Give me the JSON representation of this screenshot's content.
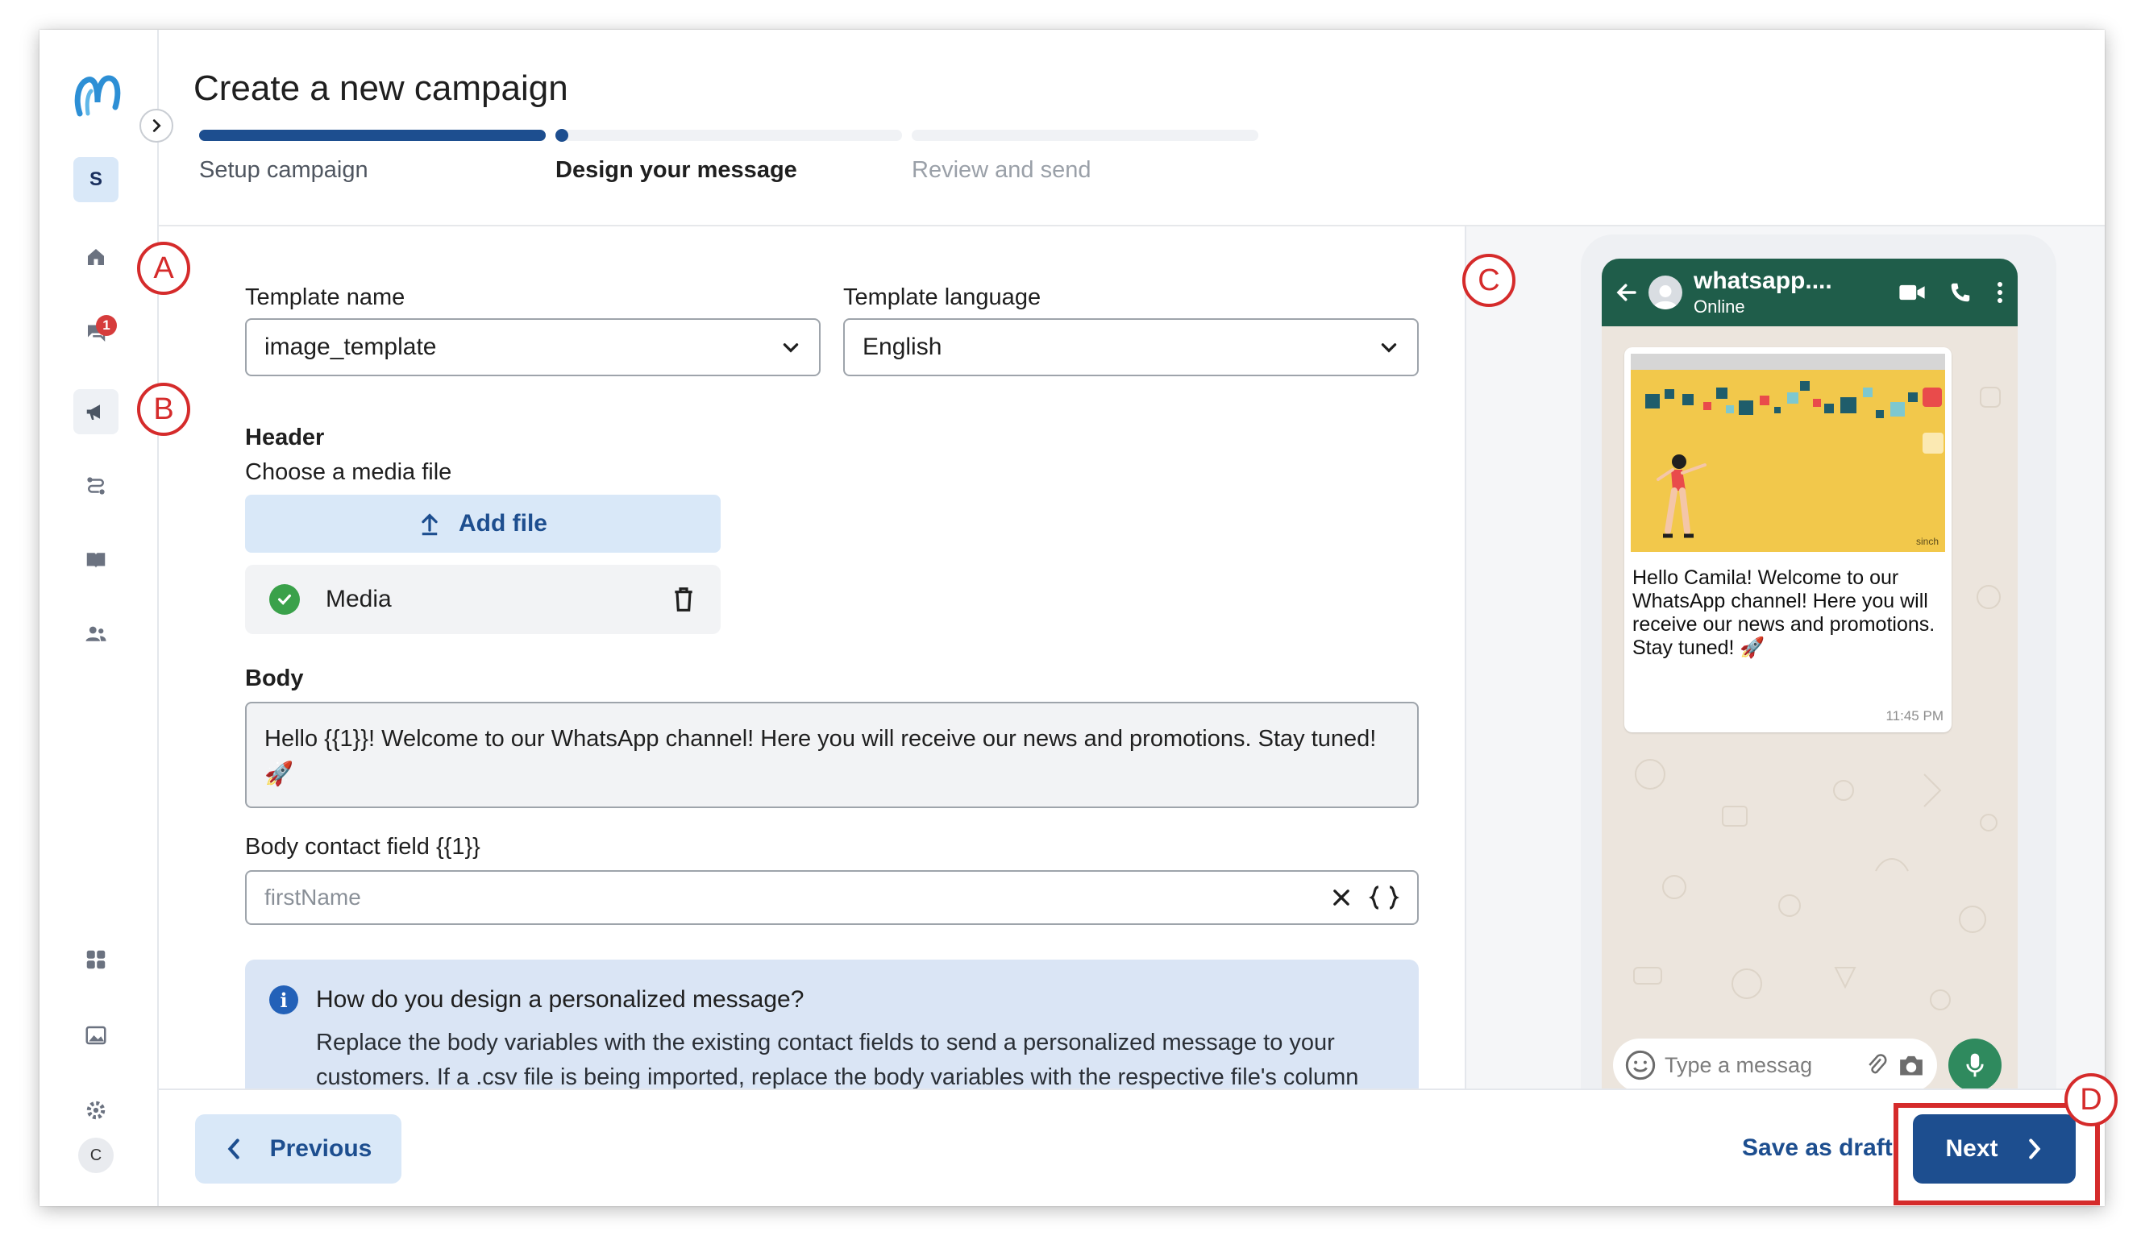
{
  "page": {
    "title": "Create a new campaign"
  },
  "sidebar": {
    "workspace_initial": "S",
    "notification_count": "1",
    "user_initial": "C"
  },
  "steps": [
    {
      "label": "Setup campaign",
      "state": "done"
    },
    {
      "label": "Design your message",
      "state": "active"
    },
    {
      "label": "Review and send",
      "state": "future"
    }
  ],
  "form": {
    "template_name_label": "Template name",
    "template_name_value": "image_template",
    "template_language_label": "Template language",
    "template_language_value": "English",
    "header_label": "Header",
    "choose_media_label": "Choose a media file",
    "add_file_label": "Add file",
    "media_file_name": "Media",
    "body_label": "Body",
    "body_text": "Hello {{1}}! Welcome to our WhatsApp channel! Here you will receive our news and promotions. Stay tuned! 🚀",
    "body_contact_field_label": "Body contact field {{1}}",
    "body_contact_field_placeholder": "firstName",
    "info_title": "How do you design a personalized message?",
    "info_text": "Replace the body variables with the existing contact fields to send a personalized message to your customers. If a .csv file is being imported, replace the body variables with the respective file's column title."
  },
  "preview": {
    "contact_name": "whatsapp....",
    "status": "Online",
    "message": "Hello Camila! Welcome to our WhatsApp channel! Here you will receive our news and promotions. Stay tuned! 🚀",
    "time": "11:45 PM",
    "input_placeholder": "Type a messag",
    "image_brand": "sinch"
  },
  "footer": {
    "previous_label": "Previous",
    "save_draft_label": "Save as draft",
    "next_label": "Next"
  },
  "callouts": {
    "a": "A",
    "b": "B",
    "c": "C",
    "d": "D"
  },
  "colors": {
    "primary": "#1d4e8f",
    "primary_light": "#d9e8f8",
    "callout_red": "#d52b2b",
    "whatsapp_green": "#1f5d4a",
    "info_bg": "#dae5f5"
  }
}
